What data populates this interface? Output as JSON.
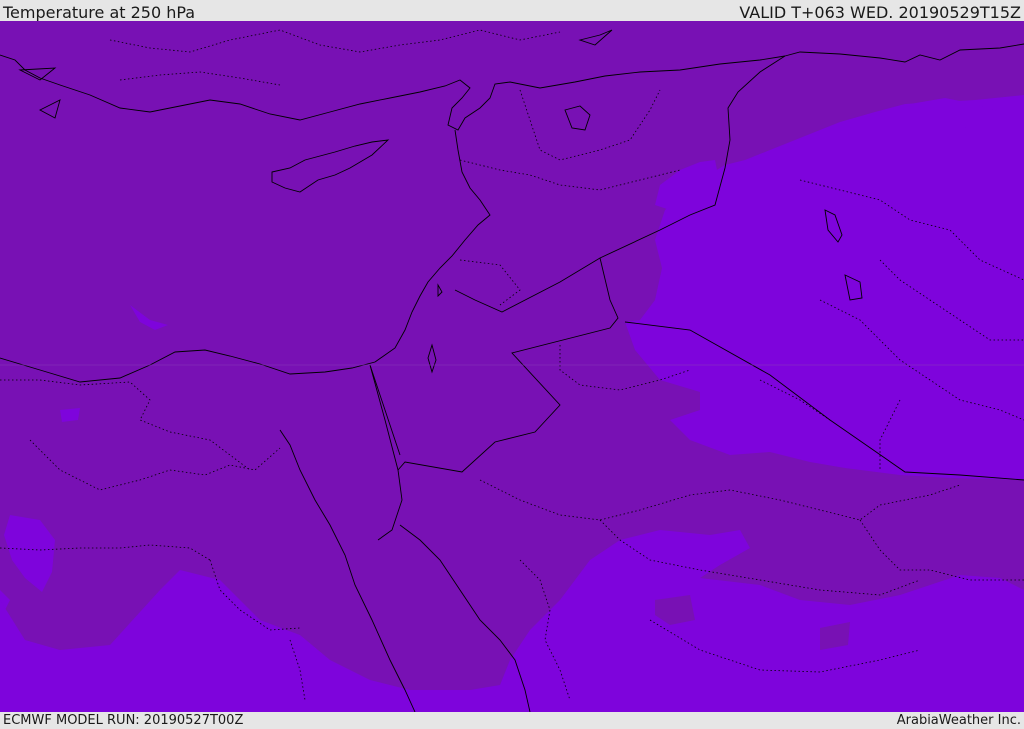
{
  "header": {
    "title": "Temperature at 250 hPa",
    "valid_time": "VALID T+063 WED. 20190529T15Z"
  },
  "footer": {
    "model_run": "ECMWF MODEL RUN: 20190527T00Z",
    "credit": "ArabiaWeather Inc."
  },
  "map": {
    "field": "Temperature at 250 hPa",
    "colors": {
      "warmer_shade": "#7811b4",
      "colder_shade": "#7e04dc",
      "coastline": "#000000",
      "borders": "#000000"
    }
  }
}
